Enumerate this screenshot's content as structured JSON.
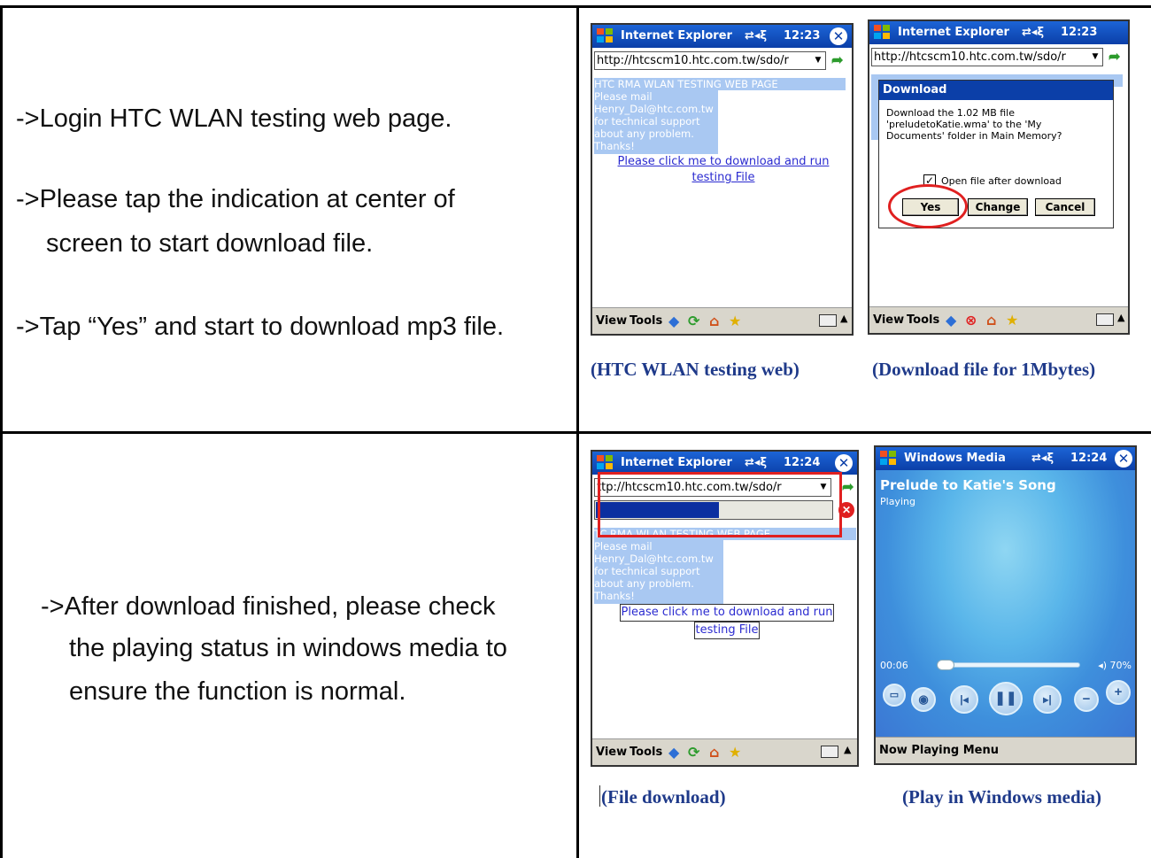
{
  "rows": [
    {
      "instructions": [
        "->Login HTC WLAN testing web page.",
        "->Please tap the indication at center of",
        "screen to start download file.",
        "->Tap “Yes” and start to download mp3 file."
      ],
      "captions": [
        "(HTC WLAN testing web)",
        "(Download file for 1Mbytes)"
      ]
    },
    {
      "instructions": [
        "->After download finished, please check",
        "the playing status in windows media to",
        "ensure the function is normal."
      ],
      "captions": [
        "(File download)",
        "(Play in Windows media)"
      ]
    }
  ],
  "ie": {
    "app_title": "Internet Explorer",
    "url": "http://htcscm10.htc.com.tw/sdo/r",
    "url_cut": "ttp://htcscm10.htc.com.tw/sdo/r",
    "page_heading": "HTC RMA WLAN TESTING WEB PAGE",
    "page_heading_cut": "TC RMA WLAN TESTING WEB PAGE",
    "page_text": "Please mail\nHenry_Dal@htc.com.tw\nfor technical support\nabout any problem.\nThanks!",
    "link_line1": "Please click me to download and run",
    "link_line2": "testing File",
    "menu_view": "View",
    "menu_tools": "Tools"
  },
  "screens": {
    "s1": {
      "time": "12:23"
    },
    "s2": {
      "time": "12:23"
    },
    "s3": {
      "time": "12:24"
    },
    "s4": {
      "time": "12:24"
    }
  },
  "download_dialog": {
    "title": "Download",
    "message": "Download the 1.02 MB file\n'preludetoKatie.wma' to the 'My\nDocuments' folder in Main Memory?",
    "checkbox_label": "Open file after download",
    "checkbox_checked": true,
    "yes": "Yes",
    "change": "Change",
    "cancel": "Cancel"
  },
  "download_progress": 0.52,
  "media": {
    "app_title": "Windows Media",
    "song": "Prelude to Katie's Song",
    "status": "Playing",
    "elapsed": "00:06",
    "volume": "70%",
    "menu": "Now Playing Menu"
  },
  "colors": {
    "title_blue": "#0b3fa8",
    "caption_blue": "#1f3a8a",
    "highlight": "#e02020"
  }
}
